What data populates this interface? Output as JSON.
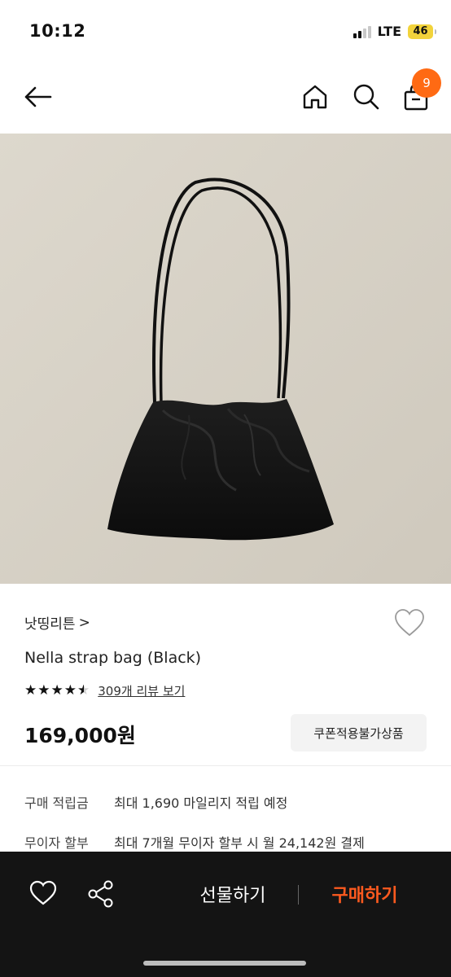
{
  "status_bar": {
    "time": "10:12",
    "network": "LTE",
    "battery": "46"
  },
  "nav": {
    "cart_count": "9",
    "icons": [
      "back-arrow-icon",
      "home-icon",
      "search-icon",
      "shopping-bag-icon"
    ]
  },
  "product": {
    "image_alt": "black-strap-bag-photo",
    "brand": "낫띵리튼",
    "brand_chevron": ">",
    "name": "Nella strap bag (Black)",
    "rating": 4.5,
    "review_text": "309개 리뷰 보기",
    "price": "169,000원",
    "coupon_label": "쿠폰적용불가상품"
  },
  "info_rows": [
    {
      "label": "구매 적립금",
      "value": "최대 1,690 마일리지 적립 예정"
    },
    {
      "label": "무이자 할부",
      "value": "최대 7개월 무이자 할부 시 월 24,142원 결제"
    }
  ],
  "action_bar": {
    "gift_label": "선물하기",
    "buy_label": "구매하기"
  },
  "colors": {
    "accent": "#ff6a13",
    "buy_text": "#ff5a1f",
    "action_bar_bg": "#141414",
    "image_bg": "#d8d3c8",
    "battery": "#f2d33b"
  }
}
